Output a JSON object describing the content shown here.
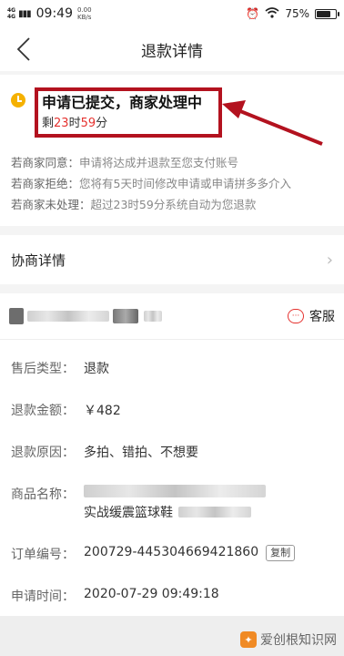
{
  "statusbar": {
    "net1": "4G",
    "net2": "4G",
    "time": "09:49",
    "speed_value": "0.00",
    "speed_unit": "KB/s",
    "battery": "75%"
  },
  "header": {
    "title": "退款详情"
  },
  "refund_status": {
    "title": "申请已提交，商家处理中",
    "countdown_prefix": "剩",
    "hours": "23",
    "hours_unit": "时",
    "minutes": "59",
    "minutes_unit": "分"
  },
  "rules": [
    {
      "key": "若商家同意：",
      "value": "申请将达成并退款至您支付账号"
    },
    {
      "key": "若商家拒绝：",
      "value": "您将有5天时间修改申请或申请拼多多介入"
    },
    {
      "key": "若商家未处理：",
      "value": "超过23时59分系统自动为您退款"
    }
  ],
  "negotiation": {
    "label": "协商详情"
  },
  "shop": {
    "service_label": "客服"
  },
  "details": {
    "type_label": "售后类型：",
    "type_value": "退款",
    "amount_label": "退款金额：",
    "amount_value": "￥482",
    "reason_label": "退款原因：",
    "reason_value": "多拍、错拍、不想要",
    "goods_label": "商品名称：",
    "goods_value": "实战缓震篮球鞋",
    "order_label": "订单编号：",
    "order_value": "200729-445304669421860",
    "copy_label": "复制",
    "time_label": "申请时间：",
    "time_value": "2020-07-29 09:49:18"
  },
  "watermark": {
    "text": "爱创根知识网"
  },
  "colors": {
    "accent_red": "#e5322f",
    "highlight_border": "#b3121f",
    "clock_yellow": "#f5b100"
  }
}
